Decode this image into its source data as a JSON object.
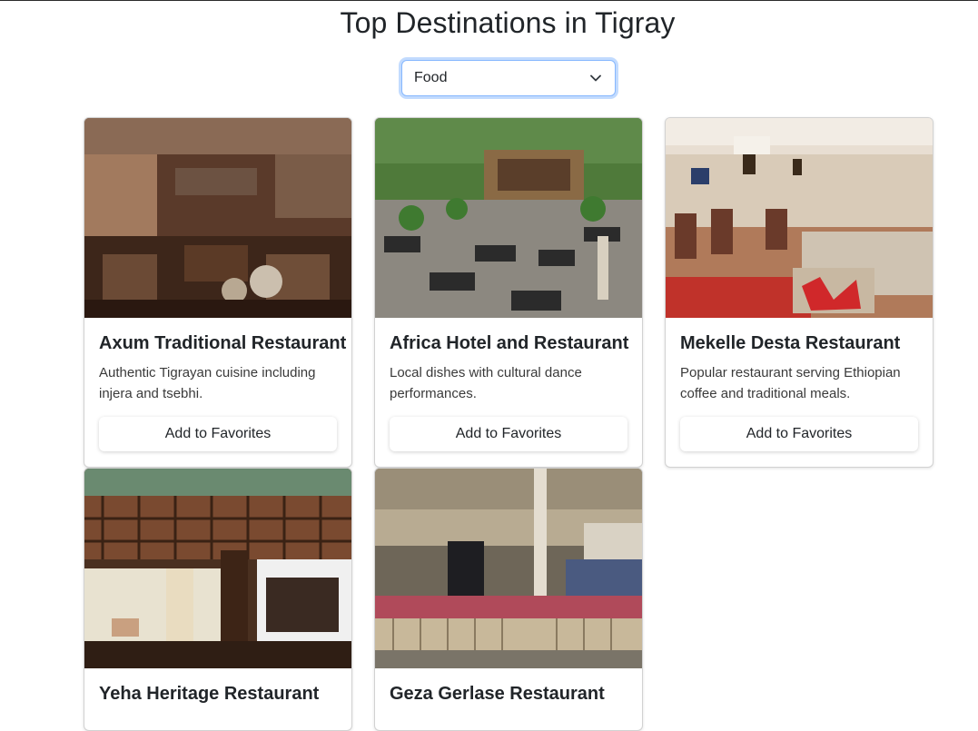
{
  "page": {
    "title": "Top Destinations in Tigray"
  },
  "filter": {
    "selected": "Food",
    "icon": "chevron-down-icon"
  },
  "cards": [
    {
      "title": "Axum Traditional Restaurant",
      "description": "Authentic Tigrayan cuisine including injera and tsebhi.",
      "button_label": "Add to Favorites"
    },
    {
      "title": "Africa Hotel and Restaurant",
      "description": "Local dishes with cultural dance performances.",
      "button_label": "Add to Favorites"
    },
    {
      "title": "Mekelle Desta Restaurant",
      "description": "Popular restaurant serving Ethiopian coffee and traditional meals.",
      "button_label": "Add to Favorites"
    },
    {
      "title": "Yeha Heritage Restaurant"
    },
    {
      "title": "Geza Gerlase Restaurant"
    }
  ]
}
